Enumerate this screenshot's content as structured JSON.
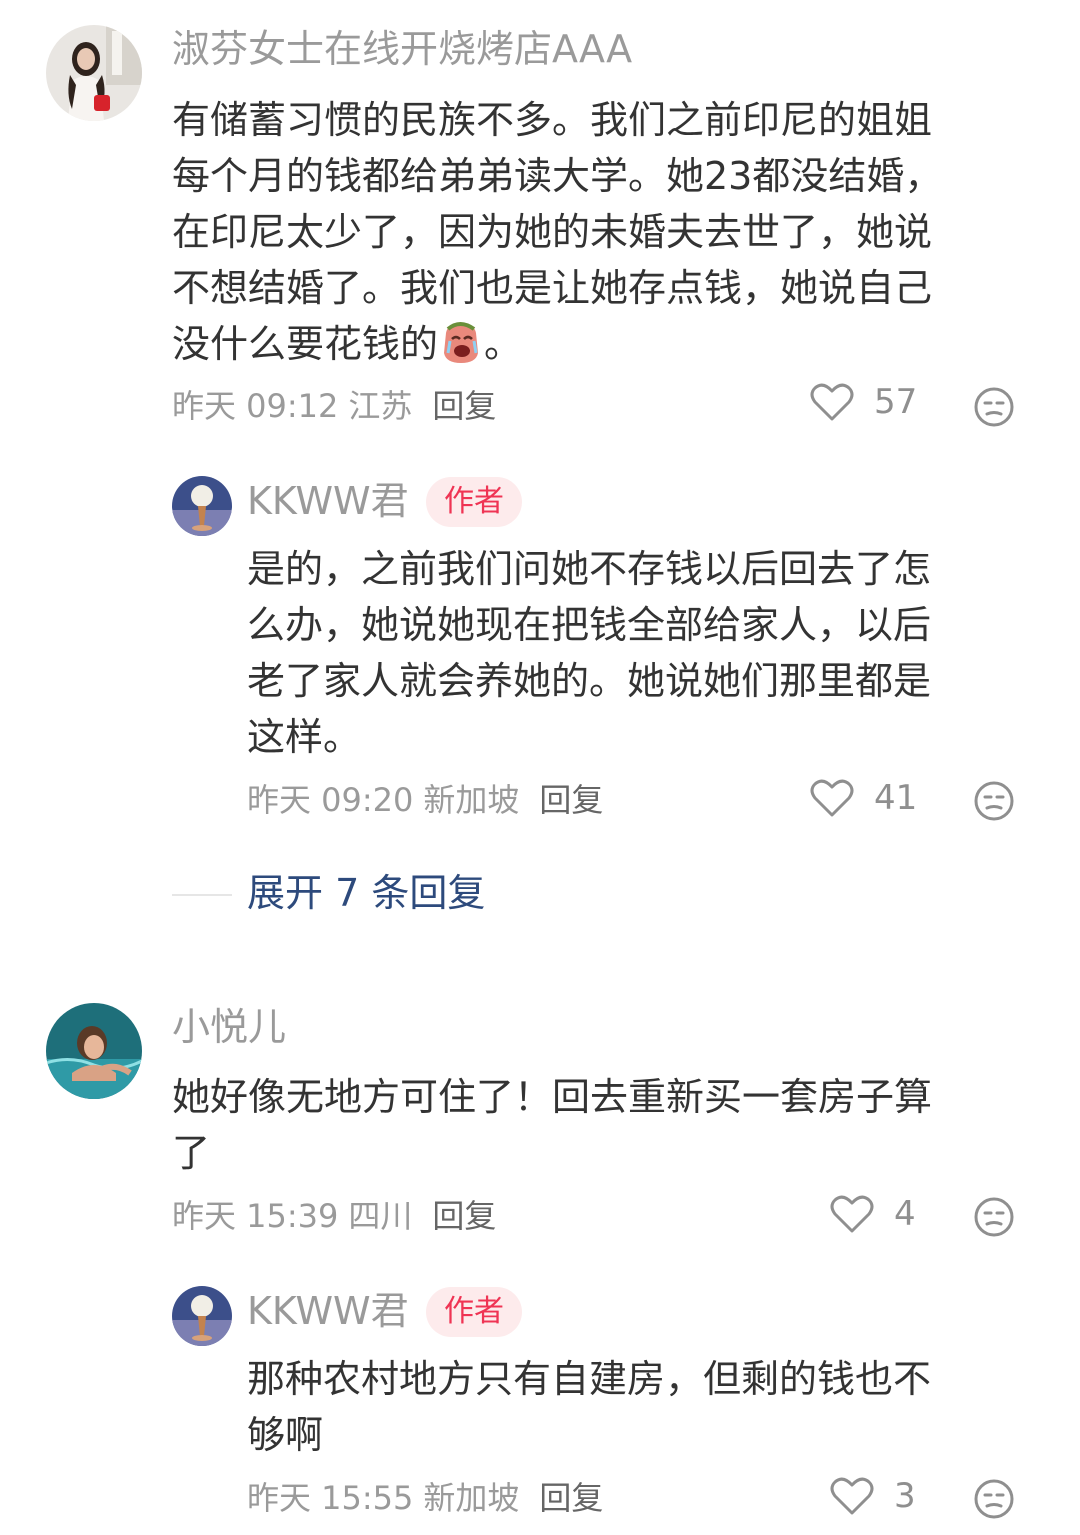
{
  "comments": [
    {
      "username": "淑芬女士在线开烧烤店AAA",
      "text_lines": [
        "有储蓄习惯的民族不多。我们之前印尼的姐姐",
        "每个月的钱都给弟弟读大学。她23都没结婚，",
        "在印尼太少了，因为她的未婚夫去世了，她说",
        "不想结婚了。我们也是让她存点钱，她说自己",
        "没什么要花钱的"
      ],
      "text_end": "。",
      "emoji": "crying-face-emoji",
      "date": "昨天 09:12",
      "location": "江苏",
      "reply_label": "回复",
      "likes": "57",
      "reply": {
        "username": "KKWW君",
        "badge": "作者",
        "text_lines": [
          "是的，之前我们问她不存钱以后回去了怎",
          "么办，她说她现在把钱全部给家人，以后",
          "老了家人就会养她的。她说她们那里都是",
          "这样。"
        ],
        "date": "昨天 09:20",
        "location": "新加坡",
        "reply_label": "回复",
        "likes": "41"
      },
      "expand_label": "展开 7 条回复"
    },
    {
      "username": "小悦儿",
      "text_lines": [
        "她好像无地方可住了！回去重新买一套房子算",
        "了"
      ],
      "date": "昨天 15:39",
      "location": "四川",
      "reply_label": "回复",
      "likes": "4",
      "reply": {
        "username": "KKWW君",
        "badge": "作者",
        "text_lines": [
          "那种农村地方只有自建房，但剩的钱也不",
          "够啊"
        ],
        "date": "昨天 15:55",
        "location": "新加坡",
        "reply_label": "回复",
        "likes": "3"
      }
    }
  ],
  "icons": {
    "like": "heart-outline-icon",
    "dislike": "meh-face-icon"
  },
  "colors": {
    "text": "#333333",
    "muted": "#9a9a9a",
    "link": "#2d4a7c",
    "badge_bg": "#fdebec",
    "badge_text": "#ef3454"
  }
}
